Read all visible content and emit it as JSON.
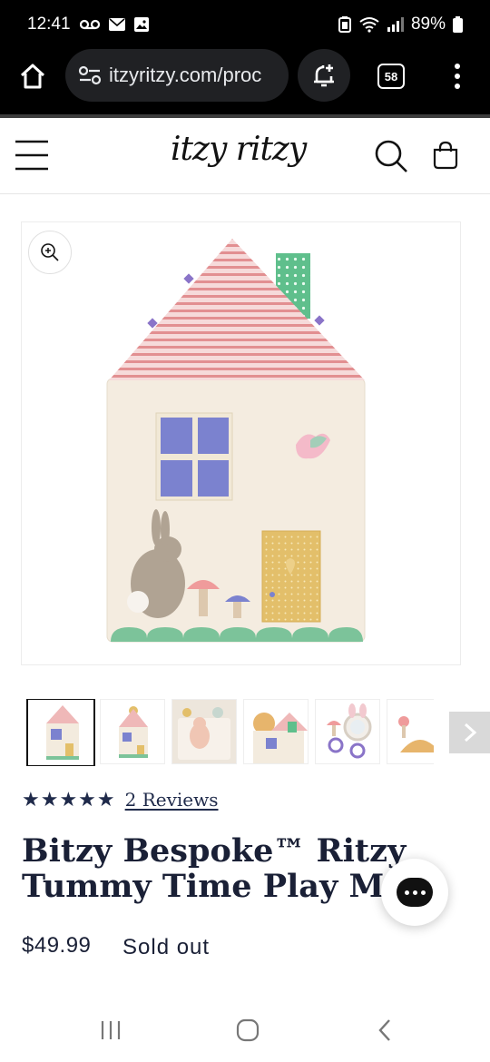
{
  "status": {
    "time": "12:41",
    "battery": "89%"
  },
  "browser": {
    "url": "itzyritzy.com/proc",
    "tab_count": "58"
  },
  "site": {
    "logo_text": "itzy ritzy"
  },
  "gallery": {
    "thumbnail_count": 6,
    "active_index": 0
  },
  "product": {
    "rating_stars": 5,
    "stars_text": "★★★★★",
    "reviews_label": "2 Reviews",
    "title_line1": "Bitzy Bespoke™ Ritzy",
    "title_line2": "Tummy Time Play Mat",
    "price": "$49.99",
    "availability": "Sold out"
  },
  "colors": {
    "brand_navy": "#1a2036",
    "roof_pink": "#e79c9c",
    "house_cream": "#f4ece0",
    "window_blue": "#7b82cf",
    "door_yellow": "#e3bf6a",
    "grass_green": "#7cc39a",
    "polka_green": "#5fbf8c"
  },
  "icons": [
    "home-icon",
    "site-settings-icon",
    "bell-plus-icon",
    "tabs-icon",
    "more-vert-icon",
    "hamburger-menu-icon",
    "search-icon",
    "cart-icon",
    "zoom-in-icon",
    "chevron-right-icon",
    "chat-icon"
  ]
}
